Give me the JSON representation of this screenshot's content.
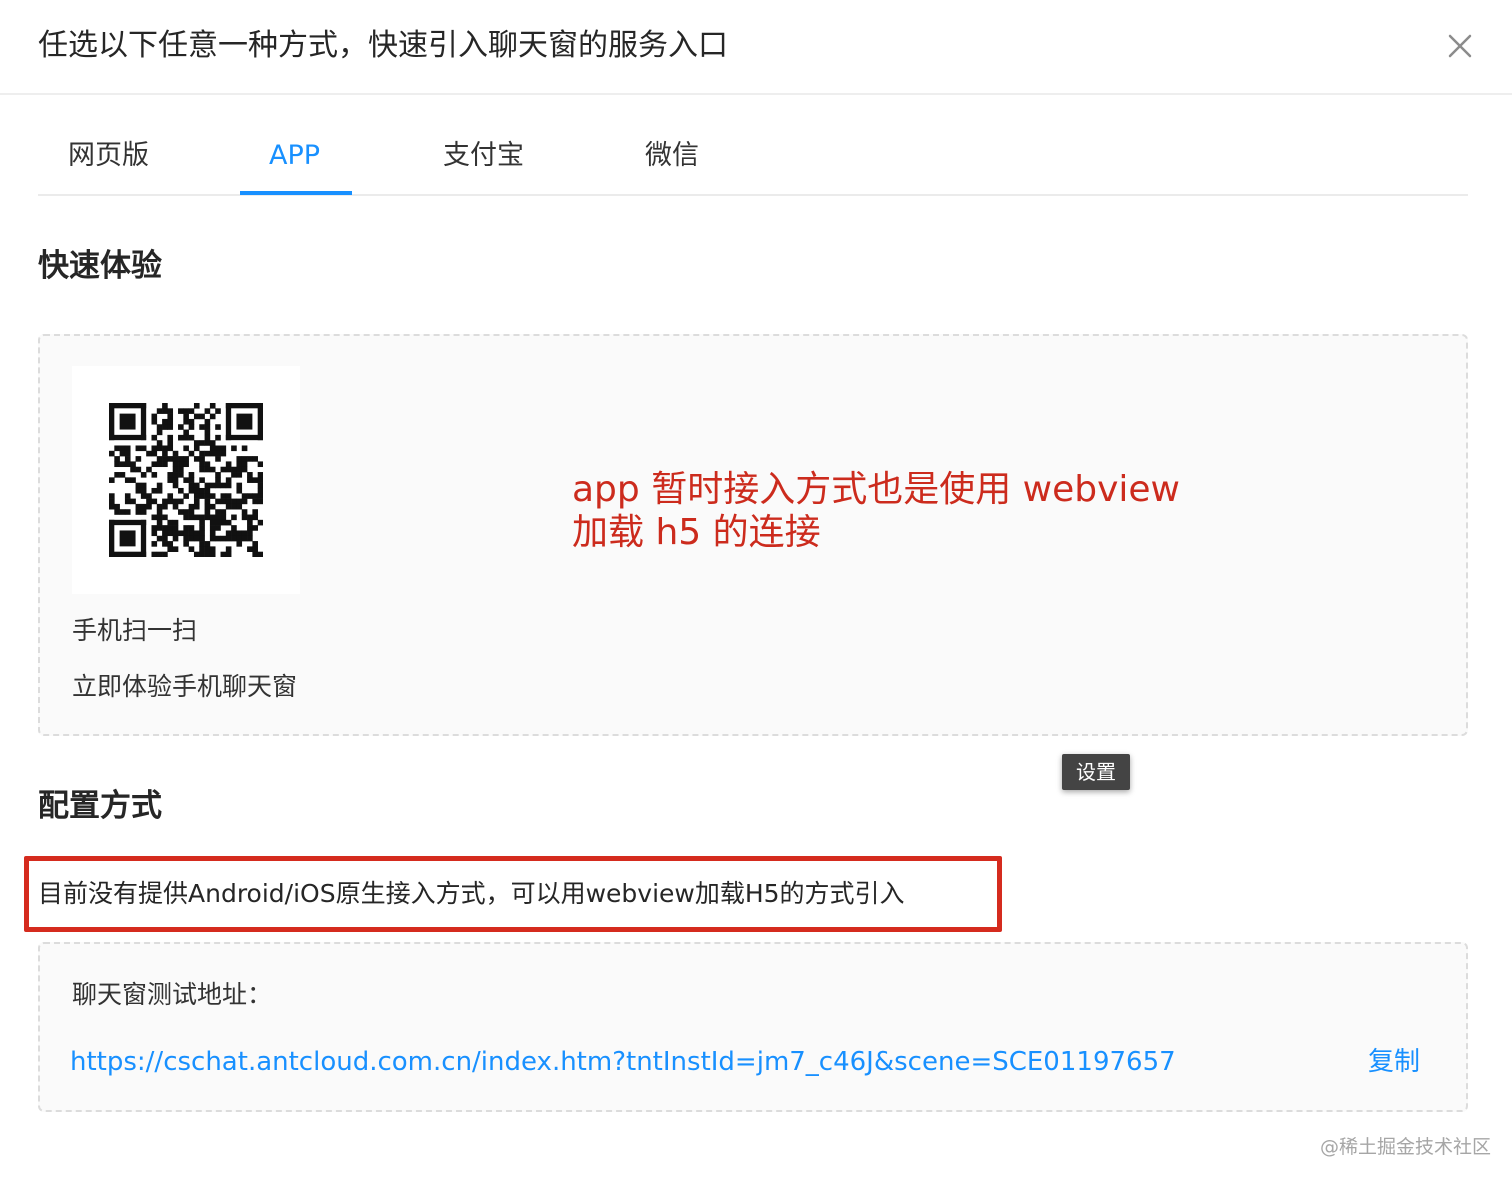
{
  "dialog": {
    "title": "任选以下任意一种方式，快速引入聊天窗的服务入口",
    "close_icon": "close-icon"
  },
  "tabs": [
    {
      "label": "网页版",
      "active": false
    },
    {
      "label": "APP",
      "active": true
    },
    {
      "label": "支付宝",
      "active": false
    },
    {
      "label": "微信",
      "active": false
    }
  ],
  "quick_experience": {
    "title": "快速体验",
    "qr_icon": "qr-code-icon",
    "scan_text": "手机扫一扫",
    "experience_text": "立即体验手机聊天窗"
  },
  "annotation": {
    "line1": "app 暂时接入方式也是使用 webview",
    "line2": "加载 h5 的连接",
    "color": "#cc2b1d"
  },
  "tooltip": {
    "label": "设置"
  },
  "config": {
    "title": "配置方式",
    "notice": "目前没有提供Android/iOS原生接入方式，可以用webview加载H5的方式引入",
    "highlight_color": "#d52b1e"
  },
  "test_address": {
    "label": "聊天窗测试地址：",
    "url": "https://cschat.antcloud.com.cn/index.htm?tntInstId=jm7_c46J&scene=SCE01197657",
    "copy_label": "复制"
  },
  "watermark": "@稀土掘金技术社区",
  "colors": {
    "accent": "#1890ff"
  }
}
